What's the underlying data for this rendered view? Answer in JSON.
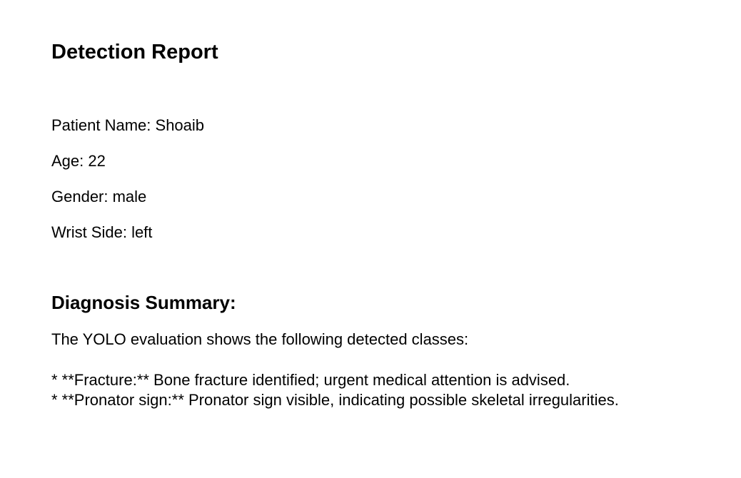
{
  "report": {
    "title": "Detection Report",
    "patient_name": "Patient Name: Shoaib",
    "age": "Age: 22",
    "gender": "Gender: male",
    "wrist_side": "Wrist Side: left"
  },
  "diagnosis": {
    "heading": "Diagnosis Summary:",
    "intro": "The YOLO evaluation shows the following detected classes:",
    "findings": [
      "* **Fracture:** Bone fracture identified; urgent medical attention is advised.",
      "* **Pronator sign:** Pronator sign visible, indicating possible skeletal irregularities."
    ]
  }
}
